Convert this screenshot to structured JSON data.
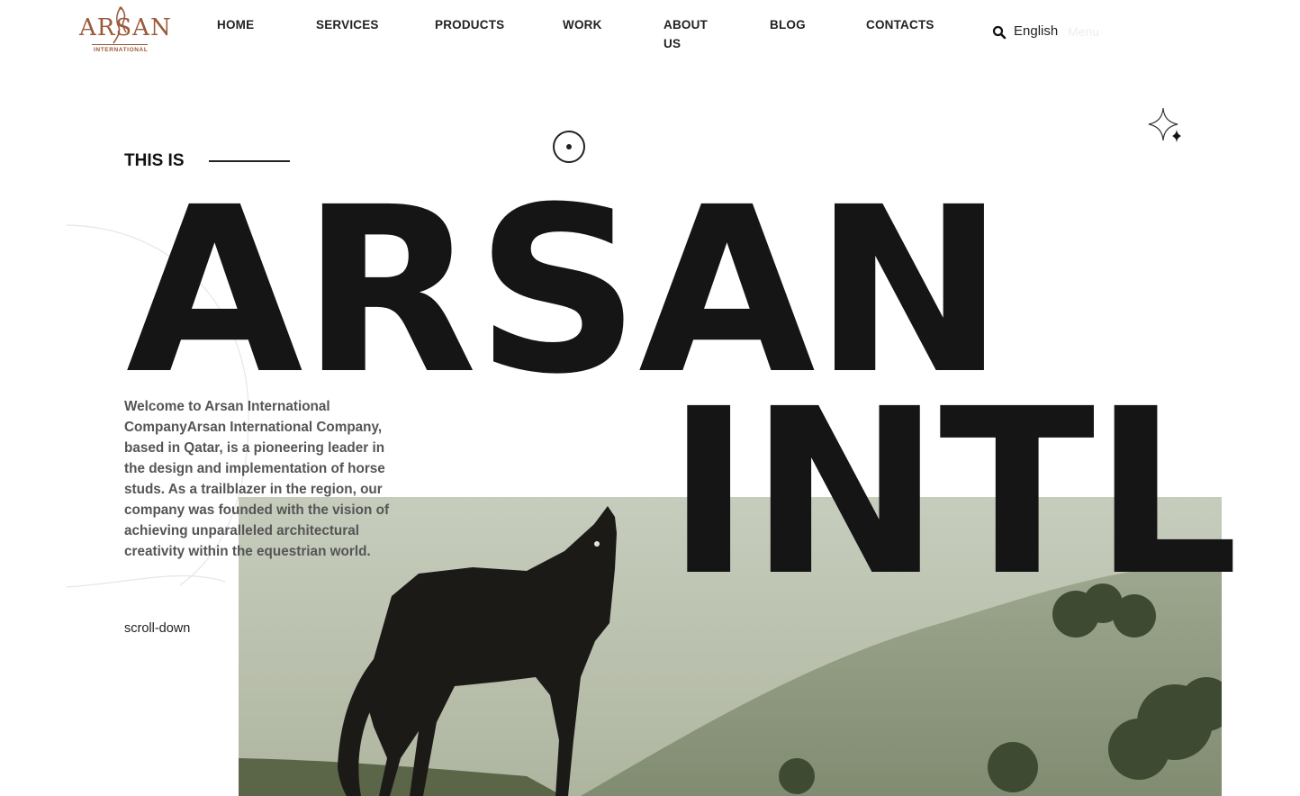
{
  "header": {
    "logo": {
      "name": "ARSAN",
      "subtitle": "INTERNATIONAL"
    },
    "nav": [
      "HOME",
      "SERVICES",
      "PRODUCTS",
      "WORK",
      "ABOUT US",
      "BLOG",
      "CONTACTS"
    ],
    "language": "English",
    "menu": "Menu"
  },
  "hero": {
    "eyebrow": "THIS IS",
    "title_line1": "ARSAN",
    "title_line2": "INTL",
    "intro": "Welcome to Arsan International CompanyArsan International Company, based in Qatar, is a pioneering leader in the design and implementation of horse studs. As a trailblazer in the region, our company was founded with the vision of achieving unparalleled architectural creativity within the equestrian world.",
    "scroll_label": "scroll-down"
  },
  "icons": {
    "search": "search-icon",
    "sparkle": "sparkle-icon",
    "dot": "circle-dot-icon"
  },
  "colors": {
    "brand": "#9b5a3c",
    "text": "#151515"
  }
}
